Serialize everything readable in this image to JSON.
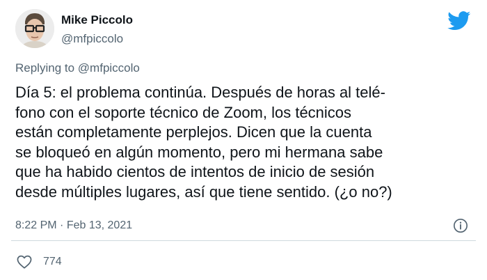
{
  "author": {
    "display_name": "Mike Piccolo",
    "handle": "@mfpiccolo",
    "avatar_icon": "avatar-portrait-glasses"
  },
  "brand": {
    "icon": "twitter-bird-icon",
    "color": "#1d9bf0"
  },
  "reply_context": {
    "prefix": "Replying to",
    "mention": "@mfpiccolo"
  },
  "tweet": {
    "lines": [
      "Día 5: el problema continúa. Después de horas al telé-",
      "fono con el soporte técnico de Zoom, los técnicos",
      "están completamente perplejos. Dicen que la cuenta",
      "se bloqueó en algún momento, pero mi hermana sabe",
      "que ha habido cientos de intentos de inicio de sesión",
      "desde múltiples lugares, así que tiene sentido. (¿o no?)"
    ],
    "time": "8:22 PM",
    "separator": "·",
    "date": "Feb 13, 2021"
  },
  "actions": {
    "like_count": "774",
    "like_icon": "heart-icon",
    "info_icon": "info-icon"
  },
  "colors": {
    "text_primary": "#0f1419",
    "text_secondary": "#536471",
    "divider": "#cfd9de"
  }
}
